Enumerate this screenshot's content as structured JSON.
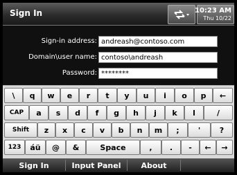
{
  "title": "Sign In",
  "clock": {
    "time": "10:23 AM",
    "date": "Thu 10/22"
  },
  "status_icons": [
    "connectivity-icon"
  ],
  "form": {
    "signin_address": {
      "label": "Sign-in address:",
      "value": "andreash@contoso.com"
    },
    "domain_user": {
      "label": "Domain\\user name:",
      "value": "contoso\\andreash"
    },
    "password": {
      "label": "Password:",
      "value": "********"
    }
  },
  "keyboard": {
    "row1": [
      "\\",
      "q",
      "w",
      "e",
      "r",
      "t",
      "y",
      "u",
      "i",
      "o",
      "p",
      "←"
    ],
    "row2": [
      "CAP",
      "a",
      "s",
      "d",
      "f",
      "g",
      "h",
      "j",
      "k",
      "l",
      "/"
    ],
    "row3": [
      "Shift",
      "z",
      "x",
      "c",
      "v",
      "b",
      "n",
      "m",
      ";",
      "'",
      "?"
    ],
    "row4": [
      "123",
      "áü",
      "@",
      "&",
      "Space",
      ",",
      ".",
      "-",
      "←",
      "→"
    ]
  },
  "softkeys": {
    "left": "Sign In",
    "middle": "Input Panel",
    "right": "About"
  }
}
